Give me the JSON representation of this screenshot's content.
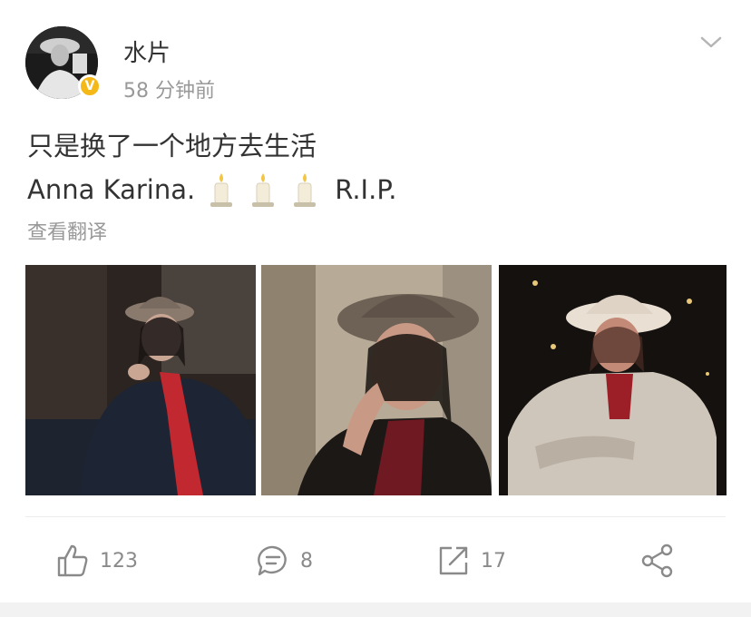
{
  "post": {
    "username": "水片",
    "verified_badge": "V",
    "timestamp": "58 分钟前",
    "text_line1": "只是换了一个地方去生活",
    "text_line2_prefix": "Anna Karina.",
    "text_line2_suffix": "R.I.P.",
    "emoji": [
      "candle",
      "candle",
      "candle"
    ],
    "translate_label": "查看翻译",
    "images": [
      {
        "description_icon": "photo-woman-hat-red-scarf-dark-room"
      },
      {
        "description_icon": "photo-woman-hat-hand-on-cheek"
      },
      {
        "description_icon": "photo-woman-white-hat-jacket-lights"
      }
    ]
  },
  "actions": {
    "like_count": "123",
    "comment_count": "8",
    "repost_count": "17"
  },
  "icons": {
    "menu": "chevron-down-icon",
    "like": "thumbs-up-icon",
    "comment": "comment-icon",
    "repost": "repost-icon",
    "share": "share-icon"
  },
  "colors": {
    "badge": "#f5b819",
    "muted_text": "#999999",
    "action_icon": "#8a8a8a"
  }
}
